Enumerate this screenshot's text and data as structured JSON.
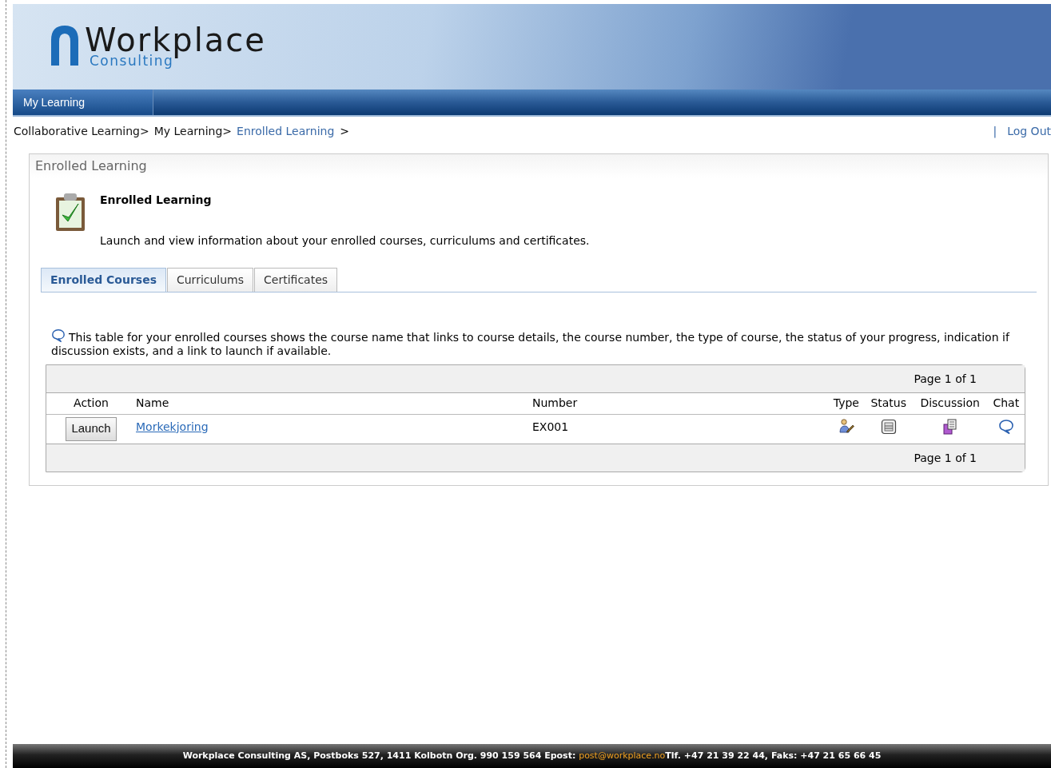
{
  "logo": {
    "name": "Workplace",
    "tagline": "Consulting"
  },
  "nav": [
    {
      "label": "My Learning",
      "selected": true
    }
  ],
  "breadcrumb": {
    "items": [
      "Collaborative Learning>",
      "My Learning>"
    ],
    "current": "Enrolled Learning",
    "separator": ">"
  },
  "user_links": {
    "separator": "|",
    "logout": "Log Out"
  },
  "panel": {
    "title": "Enrolled Learning",
    "heading": "Enrolled Learning",
    "description": "Launch and view information about your enrolled courses, curriculums and certificates."
  },
  "tabs": [
    {
      "label": "Enrolled Courses",
      "selected": true
    },
    {
      "label": "Curriculums",
      "selected": false
    },
    {
      "label": "Certificates",
      "selected": false
    }
  ],
  "help_text": "This table for your enrolled courses shows the course name that links to course details, the course number, the type of course, the status of your progress, indication if discussion exists, and a link to launch if available.",
  "table": {
    "pager_top": "Page 1 of 1",
    "pager_bottom": "Page 1 of 1",
    "columns": [
      "Action",
      "Name",
      "Number",
      "Type",
      "Status",
      "Discussion",
      "Chat"
    ],
    "rows": [
      {
        "action": "Launch",
        "name": "Morkekjoring",
        "number": "EX001"
      }
    ]
  },
  "footer": {
    "text_before": "Workplace Consulting AS, Postboks 527, 1411 Kolbotn Org. 990 159 564 Epost: ",
    "email": "post@workplace.no",
    "text_after": "Tlf. +47 21 39 22 44, Faks: +47 21 65 66 45"
  }
}
